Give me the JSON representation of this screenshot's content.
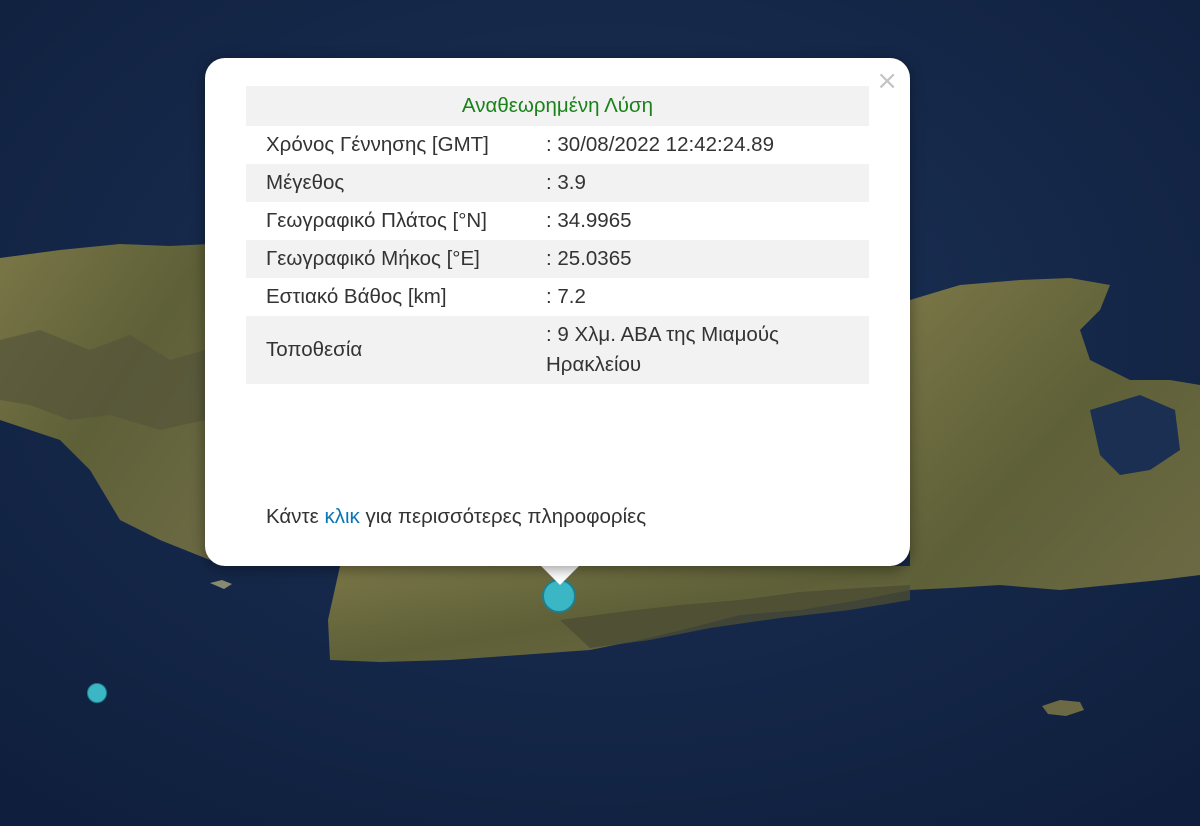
{
  "popup": {
    "header": "Αναθεωρημένη Λύση",
    "rows": [
      {
        "label": "Χρόνος Γέννησης [GMT]",
        "value": ": 30/08/2022 12:42:24.89"
      },
      {
        "label": "Μέγεθος",
        "value": ": 3.9"
      },
      {
        "label": "Γεωγραφικό Πλάτος [°N]",
        "value": ": 34.9965"
      },
      {
        "label": "Γεωγραφικό Μήκος [°E]",
        "value": ": 25.0365"
      },
      {
        "label": "Εστιακό Βάθος [km]",
        "value": ": 7.2"
      },
      {
        "label": "Τοποθεσία",
        "value": ": 9 Χλμ. ΑΒΑ της Μιαμούς Ηρακλείου"
      }
    ],
    "more_prefix": "Κάντε ",
    "more_link": "κλικ",
    "more_suffix": " για περισσότερες πληροφορίες",
    "close_glyph": "×"
  },
  "colors": {
    "sea": "#16284a",
    "land": "#6b6a3e",
    "marker": "#3bb6c4",
    "header_text": "#198219",
    "link": "#0a76b5"
  },
  "icons": {
    "close": "close-icon",
    "earthquake_marker": "circle-marker"
  }
}
